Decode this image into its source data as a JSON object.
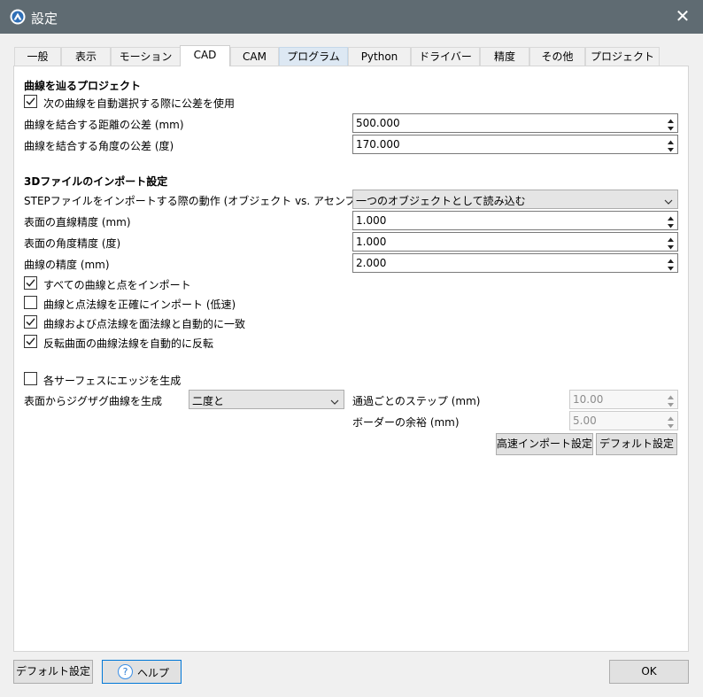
{
  "window": {
    "title": "設定",
    "close_label": "✕"
  },
  "tabs": [
    {
      "label": "一般"
    },
    {
      "label": "表示"
    },
    {
      "label": "モーション"
    },
    {
      "label": "CAD"
    },
    {
      "label": "CAM"
    },
    {
      "label": "プログラム"
    },
    {
      "label": "Python"
    },
    {
      "label": "ドライバー"
    },
    {
      "label": "精度"
    },
    {
      "label": "その他"
    },
    {
      "label": "プロジェクト"
    }
  ],
  "active_tab": "CAD",
  "hovered_tab": "プログラム",
  "curve_section": {
    "title": "曲線を辿るプロジェクト",
    "auto_select_label": "次の曲線を自動選択する際に公差を使用",
    "auto_select_checked": true,
    "distance_label": "曲線を結合する距離の公差 (mm)",
    "distance_value": "500.000",
    "angle_label": "曲線を結合する角度の公差 (度)",
    "angle_value": "170.000"
  },
  "import_section": {
    "title": "3Dファイルのインポート設定",
    "step_label": "STEPファイルをインポートする際の動作 (オブジェクト vs. アセンブリ)",
    "step_value": "一つのオブジェクトとして読み込む",
    "linear_label": "表面の直線精度 (mm)",
    "linear_value": "1.000",
    "angular_label": "表面の角度精度 (度)",
    "angular_value": "1.000",
    "curve_precision_label": "曲線の精度 (mm)",
    "curve_precision_value": "2.000",
    "checks": [
      {
        "label": "すべての曲線と点をインポート",
        "checked": true
      },
      {
        "label": "曲線と点法線を正確にインポート (低速)",
        "checked": false
      },
      {
        "label": "曲線および点法線を面法線と自動的に一致",
        "checked": true
      },
      {
        "label": "反転曲面の曲線法線を自動的に反転",
        "checked": true
      }
    ]
  },
  "edge_section": {
    "edges_label": "各サーフェスにエッジを生成",
    "edges_checked": false,
    "zigzag_label": "表面からジグザグ曲線を生成",
    "zigzag_value": "二度と",
    "step_label": "通過ごとのステップ (mm)",
    "step_value": "10.00",
    "margin_label": "ボーダーの余裕 (mm)",
    "margin_value": "5.00",
    "fast_import_button": "高速インポート設定",
    "default_button": "デフォルト設定"
  },
  "footer": {
    "defaults_button": "デフォルト設定",
    "help_button": "ヘルプ",
    "help_icon": "?",
    "ok_button": "OK"
  },
  "colors": {
    "titlebar": "#5f6b72",
    "accent": "#0078d7",
    "tab_hover": "#dde8f3"
  }
}
